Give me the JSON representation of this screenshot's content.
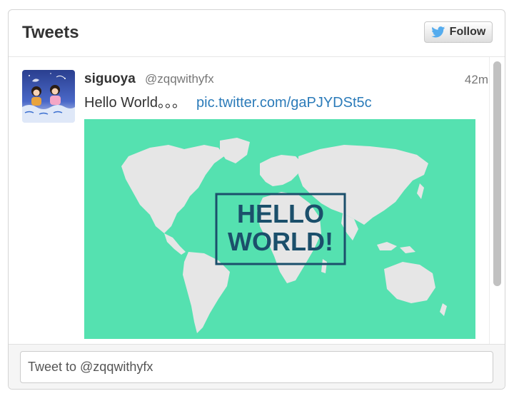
{
  "header": {
    "title": "Tweets",
    "follow_label": "Follow"
  },
  "tweet": {
    "fullname": "siguoya",
    "screenname": "@zqqwithyfx",
    "timestamp": "42m",
    "text": "Hello World。。。",
    "link": "pic.twitter.com/gaPJYDSt5c",
    "media": {
      "line1": "HELLO",
      "line2": "WORLD!",
      "background": "#55e1b0",
      "land_color": "#e6e6e6",
      "text_color": "#1b4f6b"
    }
  },
  "footer": {
    "tweet_to_placeholder": "Tweet to @zqqwithyfx"
  },
  "colors": {
    "link": "#2b7bb9",
    "title": "#333333"
  },
  "icons": {
    "follow": "twitter-bird-icon"
  }
}
